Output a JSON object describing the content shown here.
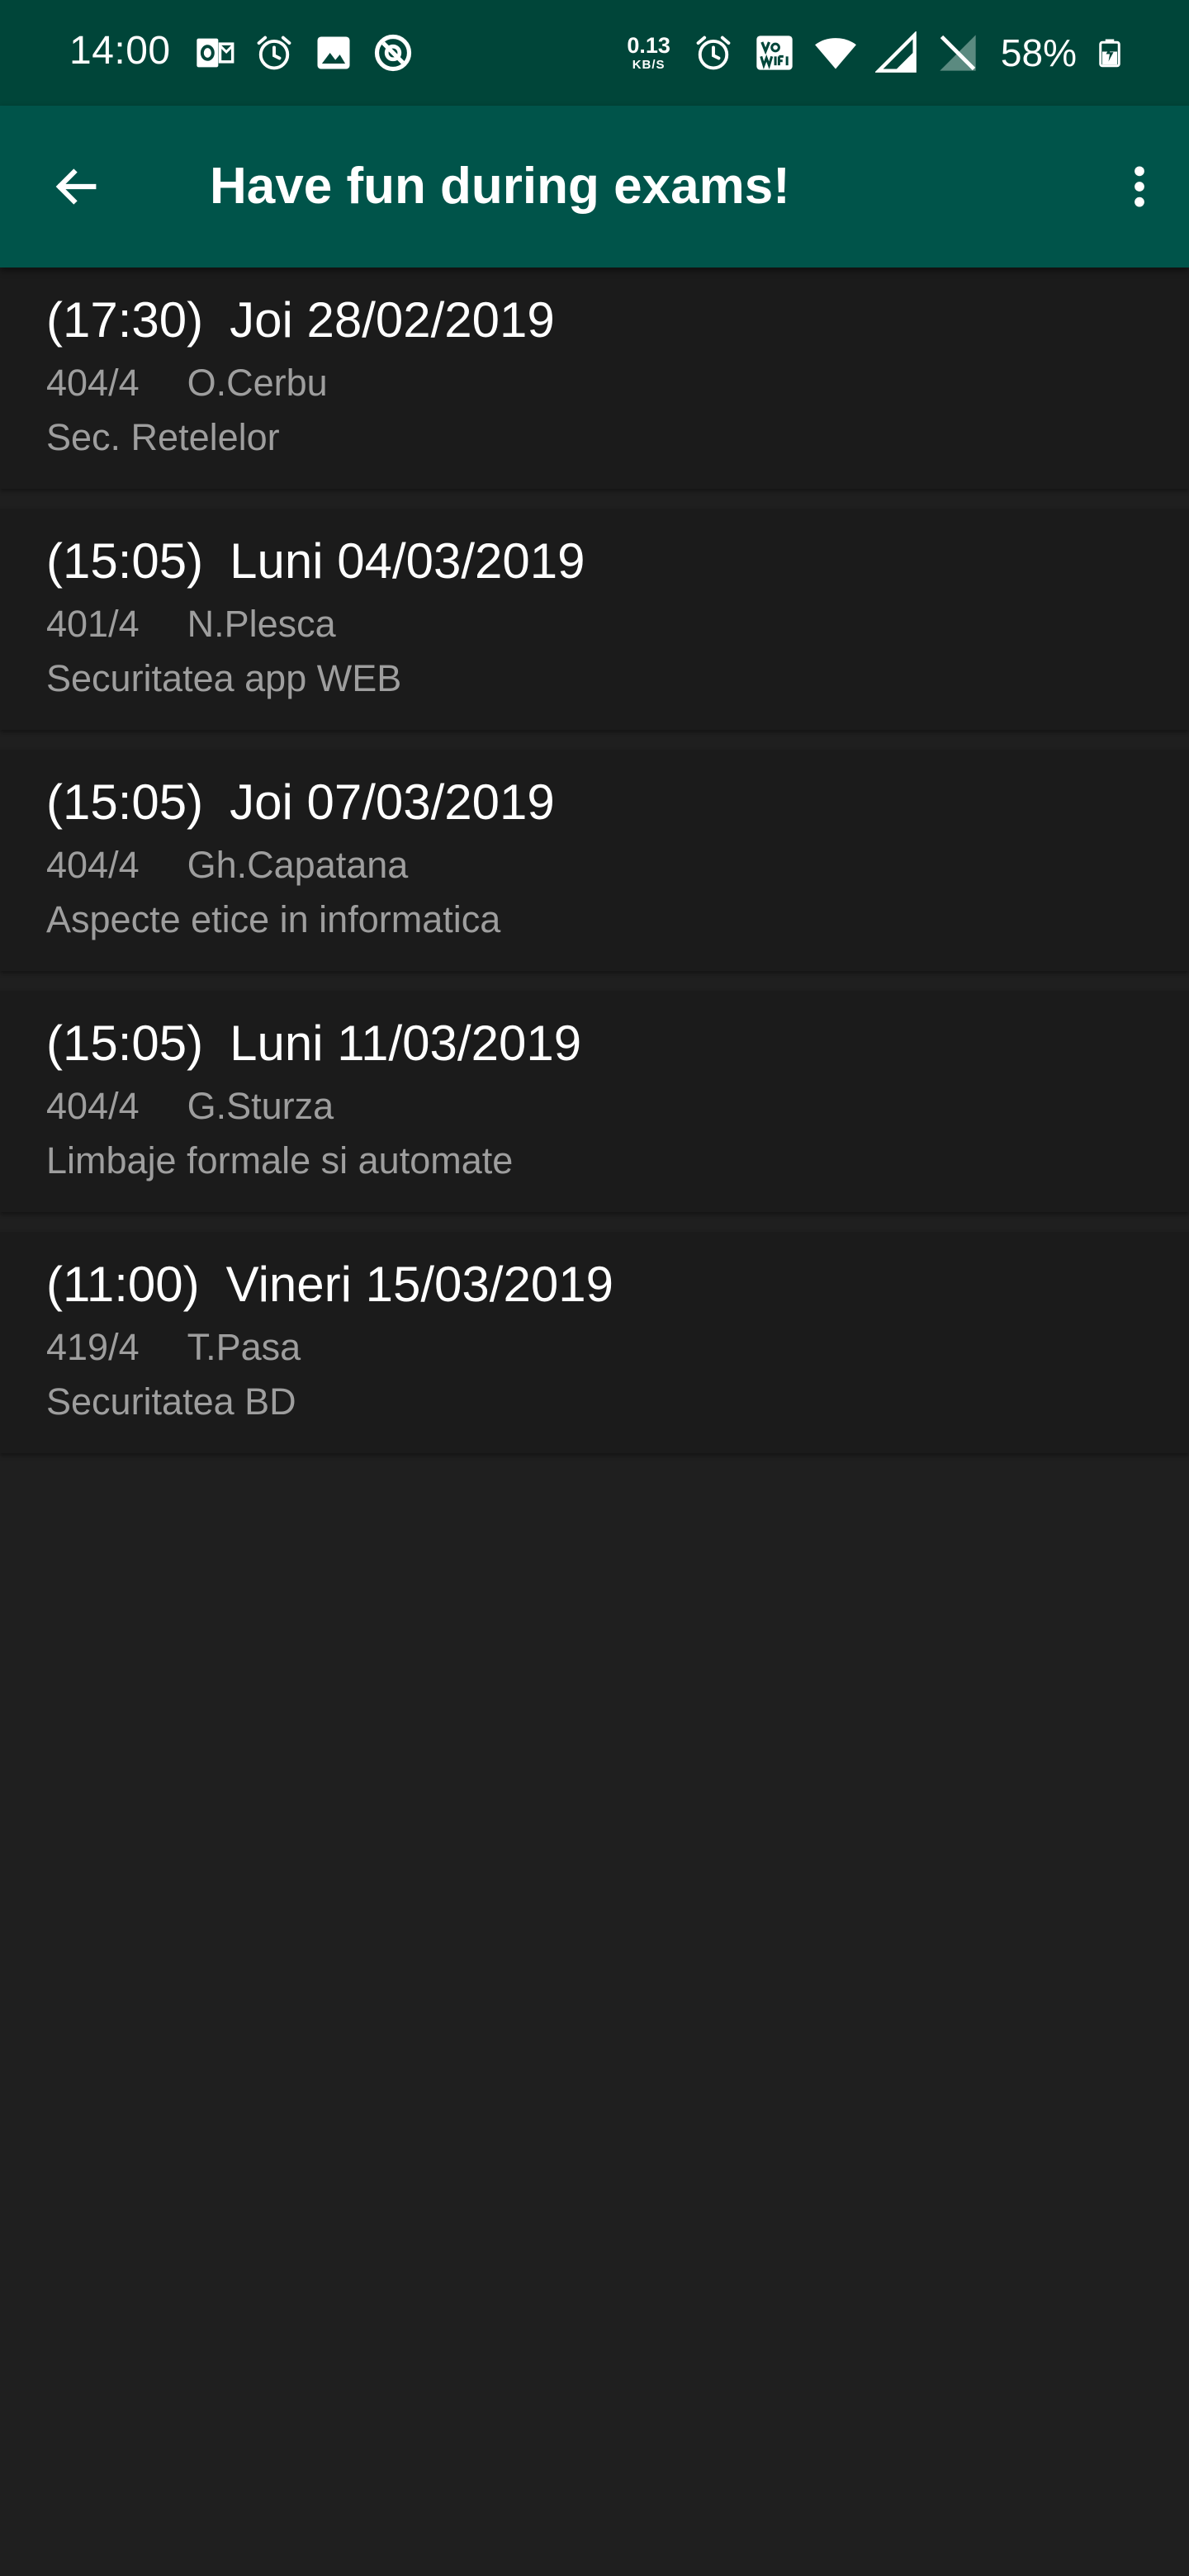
{
  "status_bar": {
    "time": "14:00",
    "left_icons": [
      "outlook-icon",
      "alarm-icon",
      "image-icon",
      "data-saver-icon"
    ],
    "net_speed_value": "0.13",
    "net_speed_unit": "KB/S",
    "right_icons": [
      "alarm-icon",
      "vowifi-icon",
      "wifi-icon",
      "signal-icon",
      "no-sim-icon"
    ],
    "battery_percent": "58%",
    "battery_state": "charging"
  },
  "app_bar": {
    "title": "Have fun during exams!",
    "back_icon": "arrow-back-icon",
    "menu_icon": "more-vert-icon"
  },
  "exams": [
    {
      "time": "(17:30)",
      "date": "Joi 28/02/2019",
      "room": "404/4",
      "teacher": "O.Cerbu",
      "subject": "Sec. Retelelor"
    },
    {
      "time": "(15:05)",
      "date": "Luni 04/03/2019",
      "room": "401/4",
      "teacher": "N.Plesca",
      "subject": "Securitatea app WEB"
    },
    {
      "time": "(15:05)",
      "date": "Joi 07/03/2019",
      "room": "404/4",
      "teacher": "Gh.Capatana",
      "subject": "Aspecte etice in informatica"
    },
    {
      "time": "(15:05)",
      "date": "Luni 11/03/2019",
      "room": "404/4",
      "teacher": "G.Sturza",
      "subject": "Limbaje formale si automate"
    },
    {
      "time": "(11:00)",
      "date": "Vineri 15/03/2019",
      "room": "419/4",
      "teacher": "T.Pasa",
      "subject": "Securitatea BD"
    }
  ],
  "colors": {
    "status_bar": "#004539",
    "app_bar": "#00544a",
    "background": "#1f1f1f",
    "card": "#1b1b1b",
    "primary_text": "#ffffff",
    "secondary_text": "#9e9e9e"
  }
}
